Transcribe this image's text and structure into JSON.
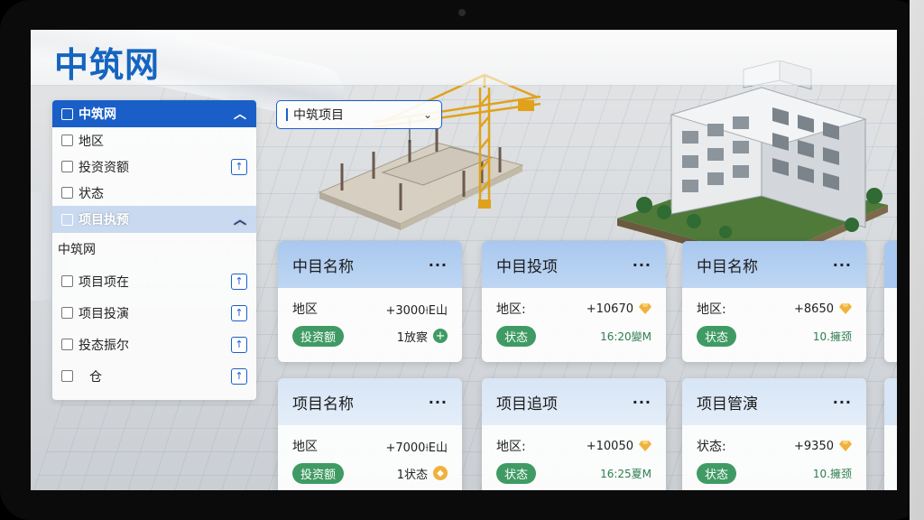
{
  "app": {
    "logo": "中筑网"
  },
  "sidebar": {
    "group1": {
      "title": "中筑网",
      "items": [
        {
          "label": "地区",
          "has_button": false
        },
        {
          "label": "投资资额",
          "has_button": true
        },
        {
          "label": "状态",
          "has_button": false
        }
      ]
    },
    "group2": {
      "title": "项目执预",
      "plain_label": "中筑网",
      "items": [
        {
          "label": "项目项在"
        },
        {
          "label": "项目投演"
        },
        {
          "label": "投态振尔"
        },
        {
          "label": "仓"
        }
      ]
    }
  },
  "dropdown": {
    "selected": "中筑项目"
  },
  "cards": [
    {
      "title": "中目名称",
      "row1_key": "地区",
      "row1_value": "+3000⟊Е山",
      "row2_pill": "投资额",
      "row2_value": "1放察",
      "row2_icon": "plus-circle-icon"
    },
    {
      "title": "中目投项",
      "row1_key": "地区:",
      "row1_value": "+10670",
      "row2_pill": "状态",
      "row2_value": "16:20變M",
      "row2_icon": ""
    },
    {
      "title": "中目名称",
      "row1_key": "地区:",
      "row1_value": "+8650",
      "row2_pill": "状态",
      "row2_value": "10.擁颈",
      "row2_icon": ""
    },
    {
      "title": "项目名称",
      "row1_key": "地区",
      "row1_value": "+7000⟊Е山",
      "row2_pill": "投资额",
      "row2_value": "1状态",
      "row2_icon": "gem-ring-icon"
    },
    {
      "title": "项目追项",
      "row1_key": "地区:",
      "row1_value": "+10050",
      "row2_pill": "状态",
      "row2_value": "16:25夏M",
      "row2_icon": ""
    },
    {
      "title": "项目管演",
      "row1_key": "状态:",
      "row1_value": "+9350",
      "row2_pill": "状态",
      "row2_value": "10.擁颈",
      "row2_icon": ""
    }
  ],
  "colors": {
    "brand": "#1565c0",
    "sidebar_header": "#1a5fc8",
    "pill_green": "#3f9b63",
    "card_header": "#a9c8ef",
    "gem_gold": "#f0b23a"
  }
}
